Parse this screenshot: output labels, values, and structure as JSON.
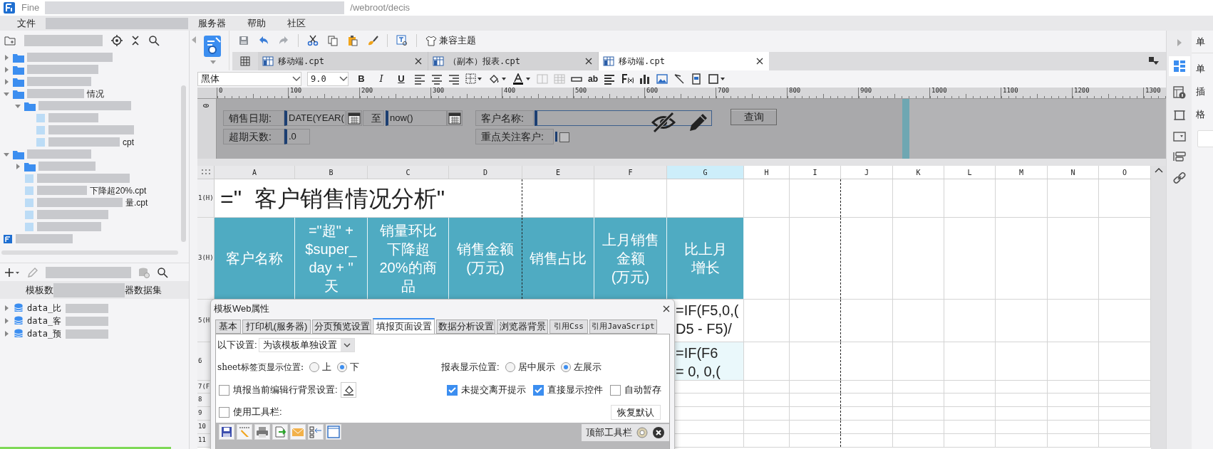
{
  "window": {
    "title_parts": [
      "Fine",
      "/webroot/decis"
    ]
  },
  "menu": [
    {
      "label": "文件"
    },
    {
      "label": "服务器"
    },
    {
      "label": "帮助"
    },
    {
      "label": "社区"
    }
  ],
  "left_panel": {
    "tree": [
      {
        "kind": "folder",
        "expanded": false
      },
      {
        "kind": "folder",
        "expanded": false
      },
      {
        "kind": "folder",
        "expanded": false
      },
      {
        "kind": "folder",
        "expanded": true,
        "label": "情况",
        "children": [
          {
            "kind": "folder",
            "expanded": true,
            "children": [
              {
                "kind": "file"
              },
              {
                "kind": "file"
              },
              {
                "kind": "file",
                "label": "cpt"
              }
            ]
          }
        ]
      },
      {
        "kind": "folder",
        "expanded": true,
        "children": [
          {
            "kind": "folder",
            "expanded": false
          },
          {
            "kind": "file"
          },
          {
            "kind": "file",
            "label": "下降超20%.cpt"
          },
          {
            "kind": "file",
            "label": "量.cpt"
          },
          {
            "kind": "file"
          },
          {
            "kind": "file"
          }
        ]
      },
      {
        "kind": "report"
      }
    ],
    "dataset_tabs": [
      {
        "label": "模板数"
      },
      {
        "label": "器数据集"
      }
    ],
    "datasets": [
      {
        "label": "data_比"
      },
      {
        "label": "data_客"
      },
      {
        "label": "data_预"
      }
    ]
  },
  "toolbar": {
    "theme_button": "兼容主题"
  },
  "tabs": [
    {
      "label": "移动端.cpt",
      "selected": false
    },
    {
      "label": "（副本）报表.cpt",
      "selected": false
    },
    {
      "label": "移动端.cpt",
      "selected": true
    }
  ],
  "format_bar": {
    "font": "黑体",
    "size": "9.0",
    "styles": [
      "B",
      "I",
      "U"
    ],
    "text_tool": "ab"
  },
  "vertical_ruler_label": "0",
  "ruler_labels": [
    "0",
    "100",
    "200",
    "300",
    "400",
    "500",
    "600",
    "700",
    "800",
    "900",
    "1000",
    "1100",
    "1200",
    "1300"
  ],
  "parameters": {
    "date_label": "销售日期:",
    "date_from": "DATE(YEAR(",
    "to_label": "至",
    "date_to": "now()",
    "overdue_label": "超期天数:",
    "overdue_value": ".0",
    "customer_label": "客户名称:",
    "focus_label": "重点关注客户:",
    "focus_checked": false,
    "query_button": "查询"
  },
  "sheet": {
    "columns": [
      {
        "label": "A",
        "selected": false
      },
      {
        "label": "B",
        "selected": false
      },
      {
        "label": "C",
        "selected": false
      },
      {
        "label": "D",
        "selected": false
      },
      {
        "label": "E",
        "selected": false
      },
      {
        "label": "F",
        "selected": false
      },
      {
        "label": "G",
        "selected": true
      },
      {
        "label": "H",
        "selected": false
      },
      {
        "label": "I",
        "selected": false
      },
      {
        "label": "J",
        "selected": false
      },
      {
        "label": "K",
        "selected": false
      },
      {
        "label": "L",
        "selected": false
      },
      {
        "label": "M",
        "selected": false
      },
      {
        "label": "N",
        "selected": false
      },
      {
        "label": "O",
        "selected": false
      }
    ],
    "rows": [
      {
        "label": "1(H)",
        "kind": "title",
        "text": "=\"  客户销售情况分析\""
      },
      {
        "label": "3(H)",
        "kind": "header",
        "cells": [
          "客户名称",
          "=\"超\" +\n$super_\nday + \"\n天",
          "销量环比下降超20%的商品",
          "销售金额\n(万元)",
          "销售占比",
          "上月销售金额\n(万元)",
          "比上月增长"
        ]
      },
      {
        "label": "5(H",
        "kind": "formula",
        "column_g": "=IF(F5,0,(\nD5 - F5)/"
      },
      {
        "label": "6",
        "kind": "formula",
        "column_g": "=IF(F6\n= 0, 0,("
      },
      {
        "label": "7(F",
        "kind": "blank"
      },
      {
        "label": "8",
        "kind": "blank"
      },
      {
        "label": "9",
        "kind": "blank"
      },
      {
        "label": "10",
        "kind": "blank"
      },
      {
        "label": "11",
        "kind": "blank"
      }
    ]
  },
  "right_panel": {
    "items": [
      "单",
      "单",
      "插",
      "格"
    ]
  },
  "dialog": {
    "title": "模板Web属性",
    "tabs": [
      {
        "label": "基本",
        "selected": false
      },
      {
        "label": "打印机(服务器)",
        "selected": false
      },
      {
        "label": "分页预览设置",
        "selected": false
      },
      {
        "label": "填报页面设置",
        "selected": true
      },
      {
        "label": "数据分析设置",
        "selected": false
      },
      {
        "label": "浏览器背景",
        "selected": false
      },
      {
        "label": "引用Css",
        "selected": false
      },
      {
        "label": "引用JavaScript",
        "selected": false
      }
    ],
    "settings_label": "以下设置:",
    "settings_value": "为该模板单独设置",
    "sheet_position": {
      "label": "sheet标签页显示位置:",
      "options": [
        {
          "label": "上",
          "selected": false
        },
        {
          "label": "下",
          "selected": true
        }
      ]
    },
    "report_position": {
      "label": "报表显示位置:",
      "options": [
        {
          "label": "居中展示",
          "selected": false
        },
        {
          "label": "左展示",
          "selected": true
        }
      ]
    },
    "row_background": {
      "label": "填报当前编辑行背景设置:",
      "checked": false
    },
    "options": [
      {
        "label": "未提交离开提示",
        "checked": true
      },
      {
        "label": "直接显示控件",
        "checked": true
      },
      {
        "label": "自动暂存",
        "checked": false
      }
    ],
    "use_toolbar": {
      "label": "使用工具栏:",
      "checked": false
    },
    "reset_button": "恢复默认",
    "toolbar_label": "顶部工具栏"
  }
}
